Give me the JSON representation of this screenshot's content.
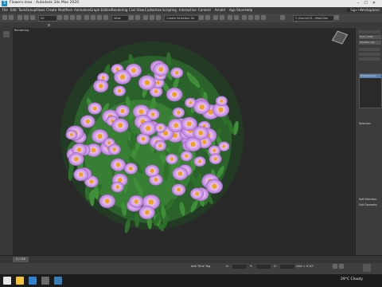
{
  "window": {
    "title": "Flowers.max - Autodesk 3ds Max 2020"
  },
  "menus": [
    "File",
    "Edit",
    "Tools",
    "Group",
    "Views",
    "Create",
    "Modifiers",
    "Animation",
    "Graph Editors",
    "Rendering",
    "Civil View",
    "Customize",
    "Scripting",
    "Interactive",
    "Content",
    "Arnold",
    "App Store",
    "Help"
  ],
  "header": {
    "sign_in": "Sign In",
    "workspace": "Workspaces:"
  },
  "toolbar": {
    "selection_filter": "All",
    "view_dropdown": "View",
    "selection_set": "Create Selection Se",
    "project": "C:\\Users\\U3...\\Max\\3ds Max"
  },
  "viewport": {
    "label": "[+][Perspective][Standard][Edged Faces]",
    "nav_label": "Rendering"
  },
  "command_panel": {
    "name_field": "Bush_1000",
    "modifier_list": "Modifier List",
    "stack_item": "Editable Poly",
    "sections": [
      "Selection",
      "Soft Selection",
      "Edit Geometry"
    ]
  },
  "timeline": {
    "frame_label": "0 / 100"
  },
  "status": {
    "add_time_tag": "Add Time Tag",
    "x": "X:",
    "y": "Y:",
    "z": "Z:",
    "grid": "Grid = 0'10\""
  },
  "taskbar": {
    "weather": "29°C  Cloudy"
  }
}
